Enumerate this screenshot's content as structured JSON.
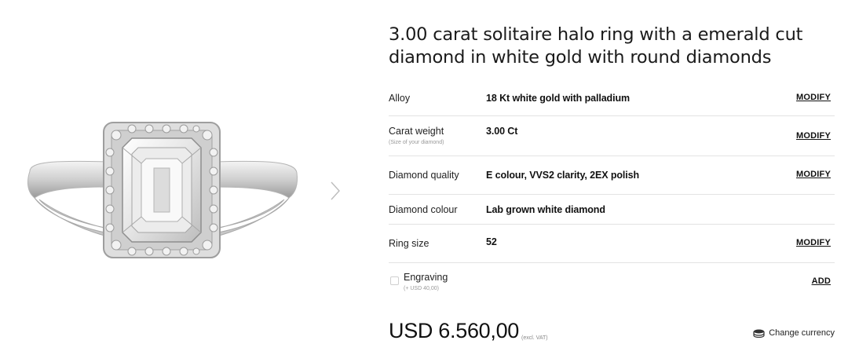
{
  "product": {
    "title_line1": "3.00 carat solitaire halo ring with a emerald cut",
    "title_line2": "diamond in white gold with round diamonds"
  },
  "options": [
    {
      "label": "Alloy",
      "sublabel": "",
      "value": "18 Kt white gold with palladium",
      "action": "MODIFY"
    },
    {
      "label": "Carat weight",
      "sublabel": "(Size of your diamond)",
      "value": "3.00 Ct",
      "action": "MODIFY"
    },
    {
      "label": "Diamond quality",
      "sublabel": "",
      "value": "E colour, VVS2 clarity, 2EX polish",
      "action": "MODIFY"
    },
    {
      "label": "Diamond colour",
      "sublabel": "",
      "value": "Lab grown white diamond",
      "action": ""
    },
    {
      "label": "Ring size",
      "sublabel": "",
      "value": "52",
      "action": "MODIFY"
    }
  ],
  "engraving": {
    "label": "Engraving",
    "sublabel": "(+ USD 40,00)",
    "action": "ADD"
  },
  "price": {
    "amount": "USD 6.560,00",
    "vat_note": "(excl. VAT)"
  },
  "currency": {
    "label": "Change currency",
    "icon": "coins-icon"
  },
  "gallery": {
    "next_icon": "chevron-right-icon"
  }
}
